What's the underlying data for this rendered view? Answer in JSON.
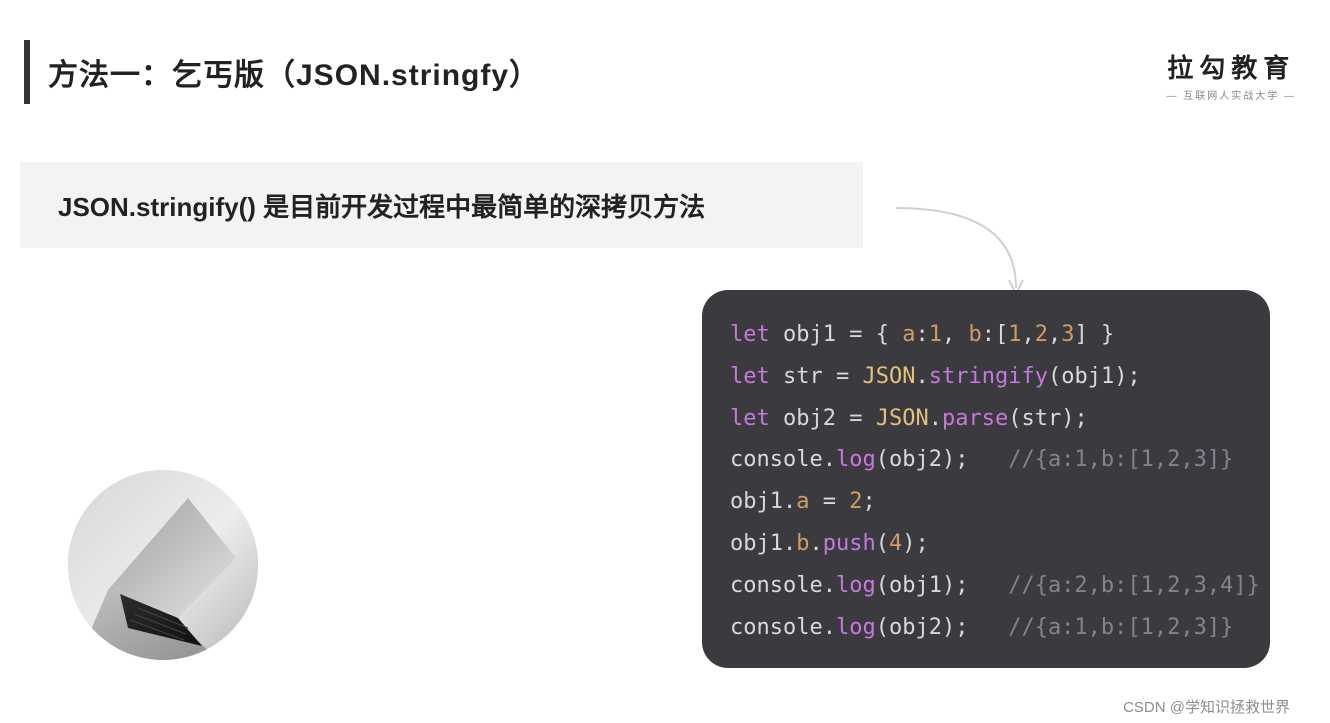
{
  "header": {
    "title": "方法一：乞丐版（JSON.stringfy）"
  },
  "logo": {
    "main": "拉勾教育",
    "sub": "— 互联网人实战大学 —"
  },
  "banner": {
    "text": "JSON.stringify() 是目前开发过程中最简单的深拷贝方法"
  },
  "code": {
    "l1_let": "let",
    "l1_obj1": "obj1",
    "l1_a": "a",
    "l1_b": "b",
    "l2_let": "let",
    "l2_str": "str",
    "l2_json": "JSON",
    "l2_stringify": "stringify",
    "l2_obj1": "obj1",
    "l3_let": "let",
    "l3_obj2": "obj2",
    "l3_json": "JSON",
    "l3_parse": "parse",
    "l3_str": "str",
    "l4_console": "console",
    "l4_log": "log",
    "l4_obj2": "obj2",
    "l4_cmt": "//{a:1,b:[1,2,3]}",
    "l5_obj1": "obj1",
    "l5_a": "a",
    "l6_obj1": "obj1",
    "l6_b": "b",
    "l6_push": "push",
    "l7_console": "console",
    "l7_log": "log",
    "l7_obj1": "obj1",
    "l7_cmt": "//{a:2,b:[1,2,3,4]}",
    "l8_console": "console",
    "l8_log": "log",
    "l8_obj2": "obj2",
    "l8_cmt": "//{a:1,b:[1,2,3]}",
    "n1": "1",
    "n2": "2",
    "n3": "3",
    "n4": "4"
  },
  "attribution": "CSDN @学知识拯救世界"
}
